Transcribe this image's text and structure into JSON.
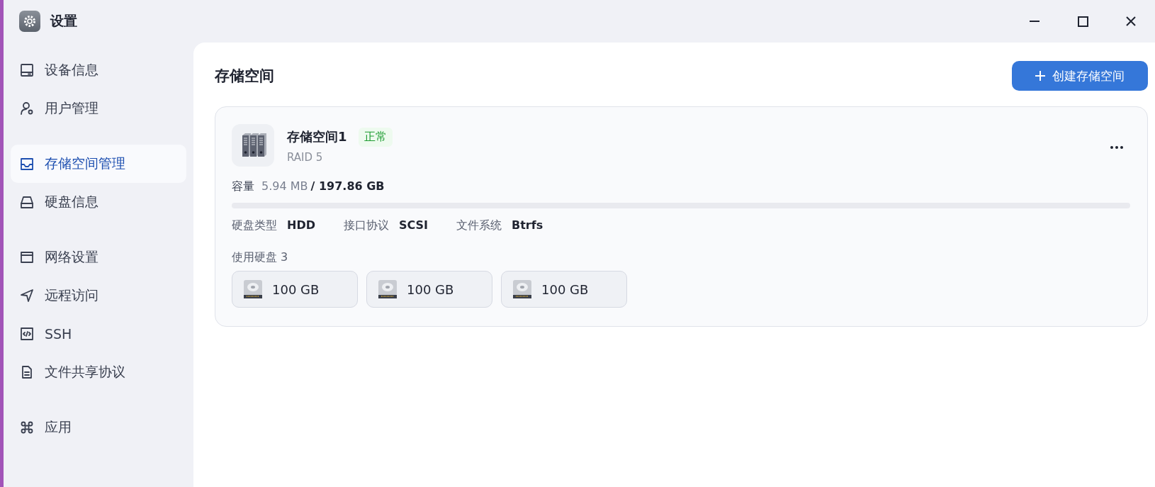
{
  "window": {
    "title": "设置"
  },
  "sidebar": {
    "groups": [
      {
        "items": [
          {
            "label": "设备信息",
            "kind": "device",
            "selected": false
          },
          {
            "label": "用户管理",
            "kind": "user",
            "selected": false
          }
        ]
      },
      {
        "items": [
          {
            "label": "存储空间管理",
            "kind": "storage",
            "selected": true
          },
          {
            "label": "硬盘信息",
            "kind": "disk",
            "selected": false
          }
        ]
      },
      {
        "items": [
          {
            "label": "网络设置",
            "kind": "network",
            "selected": false
          },
          {
            "label": "远程访问",
            "kind": "remote",
            "selected": false
          },
          {
            "label": "SSH",
            "kind": "code",
            "selected": false
          },
          {
            "label": "文件共享协议",
            "kind": "file",
            "selected": false
          }
        ]
      },
      {
        "items": [
          {
            "label": "应用",
            "kind": "apps",
            "selected": false
          }
        ]
      }
    ]
  },
  "page": {
    "title": "存储空间",
    "create_button": "创建存储空间",
    "pools": [
      {
        "name": "存储空间1",
        "status": "正常",
        "raid": "RAID 5",
        "capacity_label": "容量",
        "used": "5.94 MB",
        "total": "/ 197.86 GB",
        "level": 0,
        "specs": [
          {
            "label": "硬盘类型",
            "value": "HDD"
          },
          {
            "label": "接口协议",
            "value": "SCSI"
          },
          {
            "label": "文件系统",
            "value": "Btrfs"
          }
        ],
        "disks_label": "使用硬盘 3",
        "disks": [
          {
            "size": "100 GB"
          },
          {
            "size": "100 GB"
          },
          {
            "size": "100 GB"
          }
        ]
      }
    ]
  }
}
